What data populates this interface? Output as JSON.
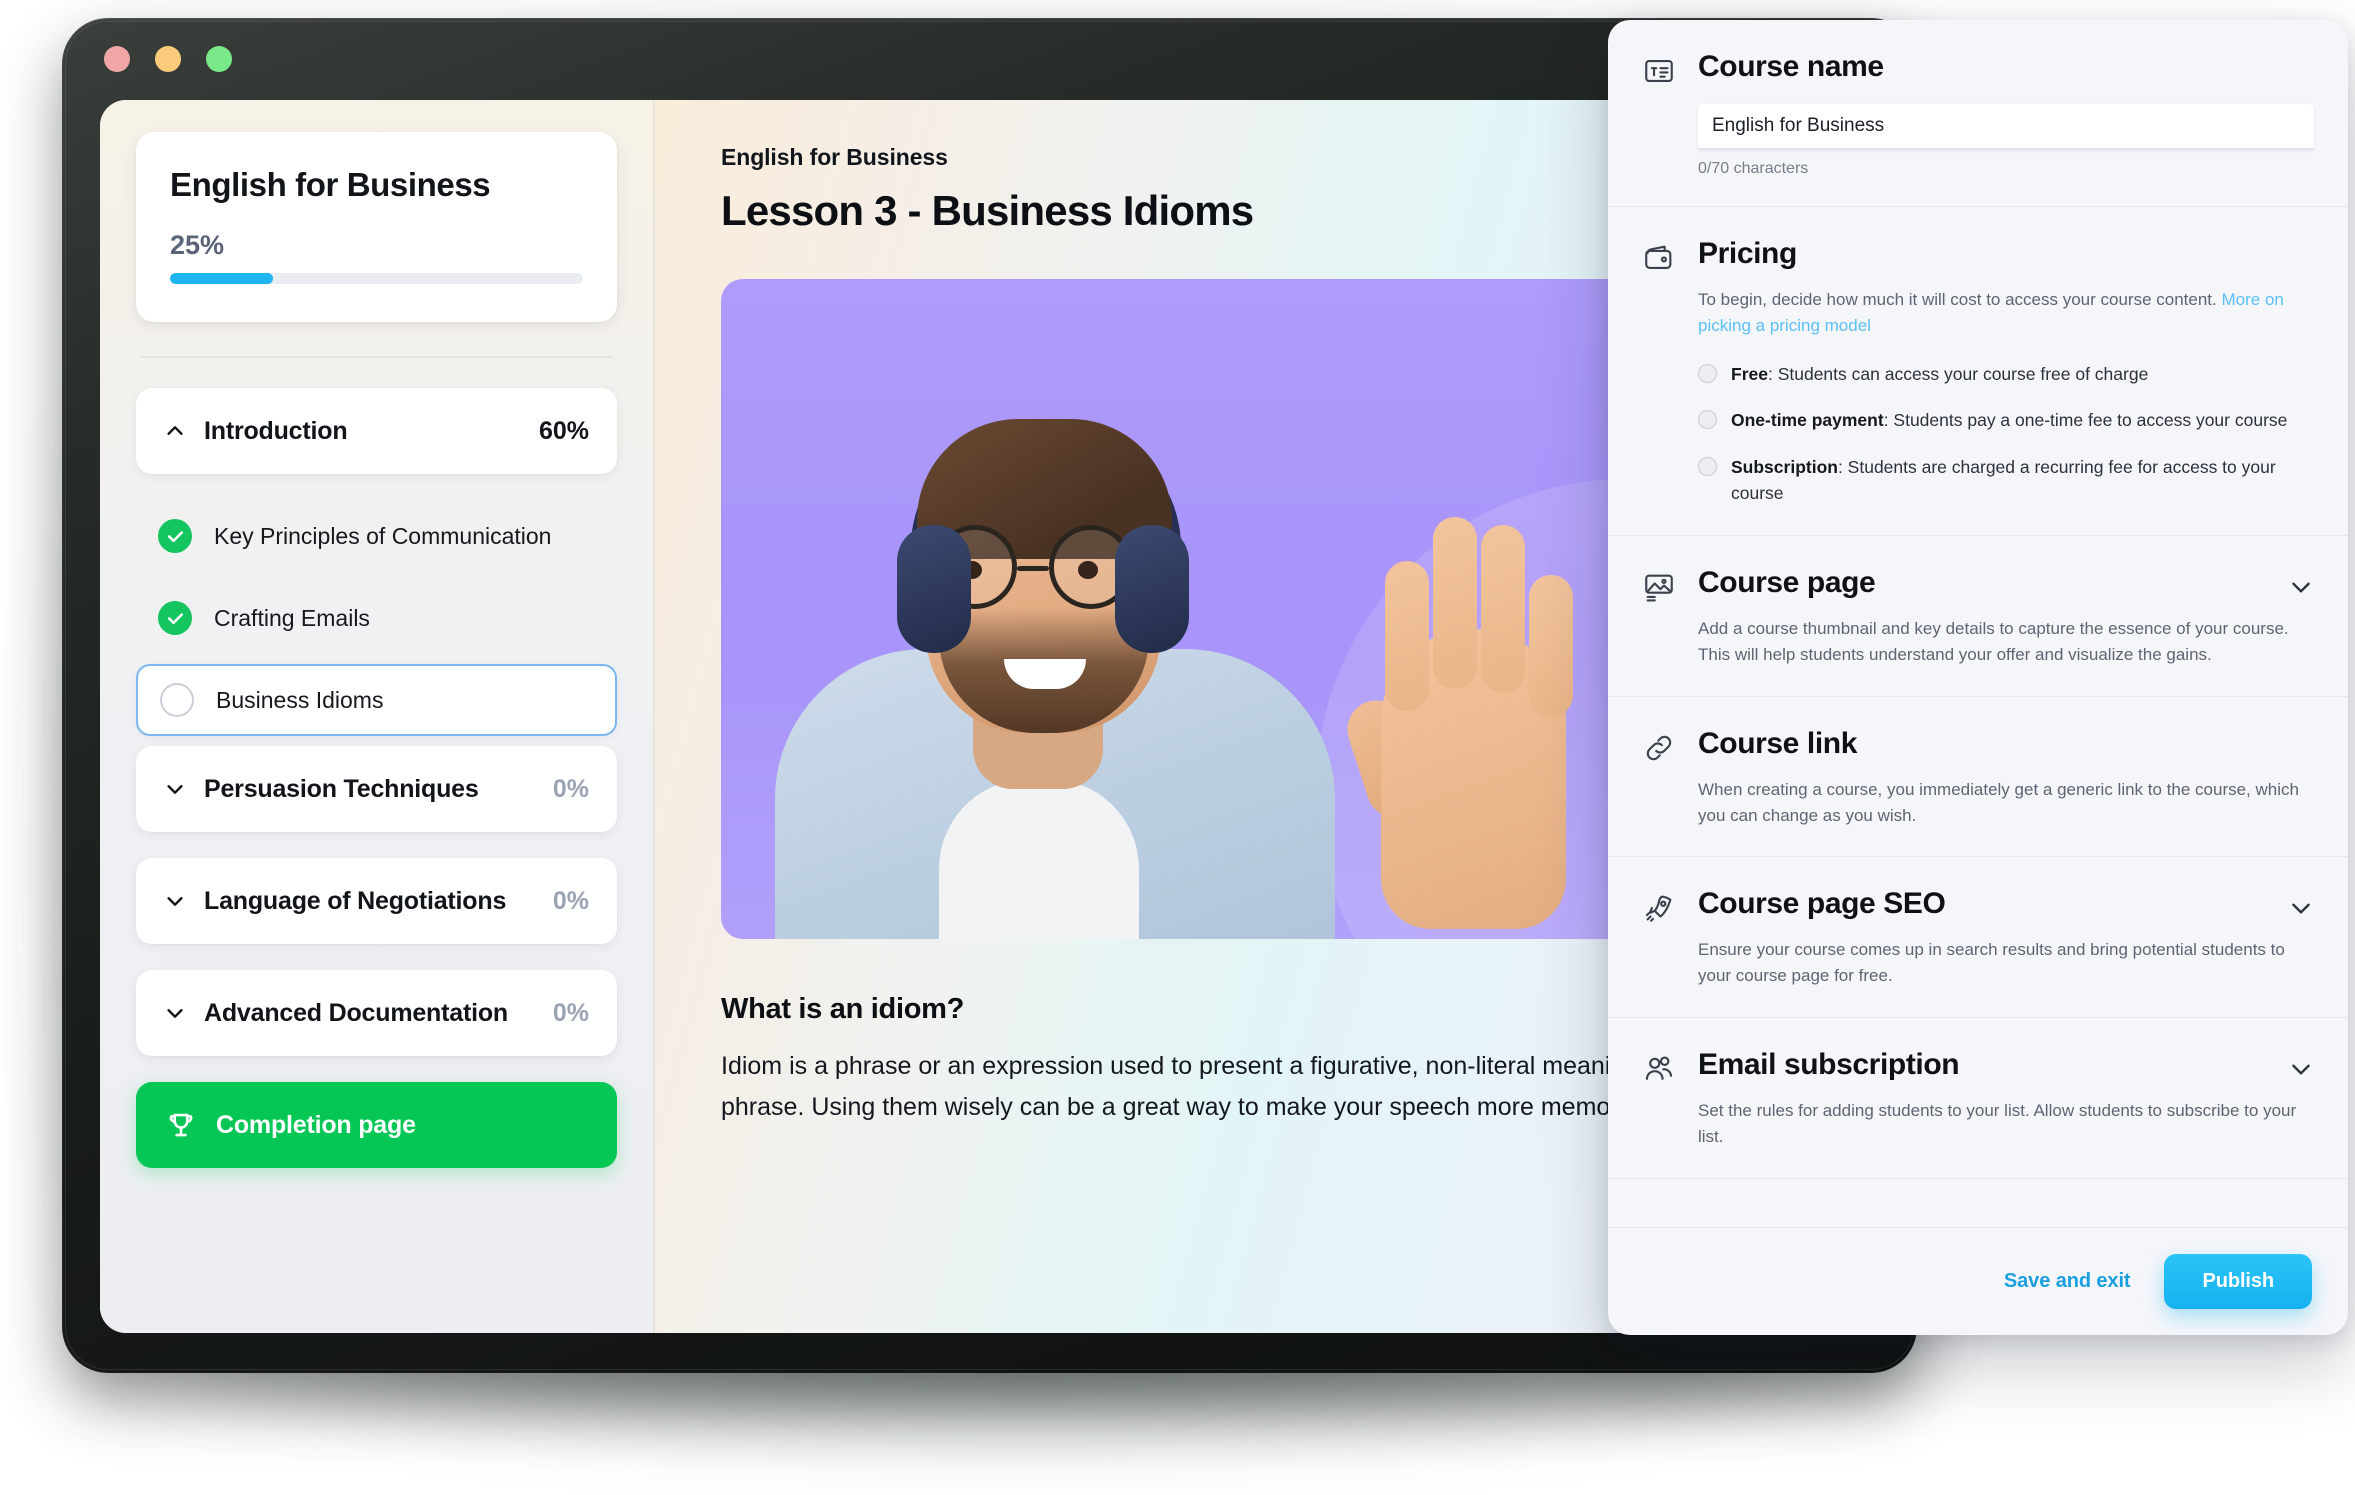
{
  "window": {
    "traffic_lights": [
      "close",
      "minimize",
      "zoom"
    ]
  },
  "sidebar": {
    "course_title": "English for Business",
    "progress_label": "25%",
    "progress_value": 25,
    "sections": [
      {
        "name": "Introduction",
        "percent": "60%",
        "expanded": true,
        "chevron": "chevron-up-icon"
      },
      {
        "name": "Persuasion Techniques",
        "percent": "0%",
        "expanded": false,
        "chevron": "chevron-down-icon"
      },
      {
        "name": "Language of Negotiations",
        "percent": "0%",
        "expanded": false,
        "chevron": "chevron-down-icon"
      },
      {
        "name": "Advanced Documentation",
        "percent": "0%",
        "expanded": false,
        "chevron": "chevron-down-icon"
      }
    ],
    "lessons": [
      {
        "label": "Key Principles of Communication",
        "state": "done"
      },
      {
        "label": "Crafting Emails",
        "state": "done"
      },
      {
        "label": "Business Idioms",
        "state": "current"
      }
    ],
    "completion_button": {
      "label": "Completion page",
      "icon": "trophy-icon",
      "color": "#06c755"
    }
  },
  "main": {
    "breadcrumb": "English for Business",
    "lesson_title": "Lesson 3 - Business Idioms",
    "hero_alt": "smiling man with headphones waving",
    "body_heading": "What is an idiom?",
    "body_paragraph": "Idiom is a phrase or an expression used to present a figurative, non-literal meaning attached to the phrase. Using them wisely can be a great way to make your speech more memorable."
  },
  "panel": {
    "course_name": {
      "title": "Course name",
      "icon": "text-field-icon",
      "value": "English for Business",
      "placeholder": "Course name",
      "hint": "0/70 characters"
    },
    "pricing": {
      "title": "Pricing",
      "icon": "wallet-icon",
      "description": "To begin, decide how much it will cost to access your course content. ",
      "link": "More on picking a pricing model",
      "options": [
        {
          "bold": "Free",
          "rest": ": Students can access your course free of charge",
          "selected": false
        },
        {
          "bold": "One-time payment",
          "rest": ": Students pay a one-time fee to access your course",
          "selected": false
        },
        {
          "bold": "Subscription",
          "rest": ": Students are charged a recurring fee for access to your course",
          "selected": false
        }
      ]
    },
    "course_page": {
      "title": "Course page",
      "icon": "image-icon",
      "description": "Add a course thumbnail and key details to capture the essence of your course.  This will help students understand your offer and visualize the gains.",
      "chevron": "chevron-down-icon"
    },
    "course_link": {
      "title": "Course link",
      "icon": "link-icon",
      "description": "When creating a course, you immediately get a generic link to the course, which you can change as you wish."
    },
    "course_seo": {
      "title": "Course page SEO",
      "icon": "rocket-icon",
      "description": "Ensure your course comes up in search results and bring potential students to your course page for free.",
      "chevron": "chevron-down-icon"
    },
    "email_subscription": {
      "title": "Email subscription",
      "icon": "people-icon",
      "description": "Set the rules for adding students to your list. Allow students to subscribe to your list.",
      "chevron": "chevron-down-icon"
    },
    "footer": {
      "save_label": "Save and exit",
      "publish_label": "Publish",
      "accent": "#16b2f0"
    }
  }
}
